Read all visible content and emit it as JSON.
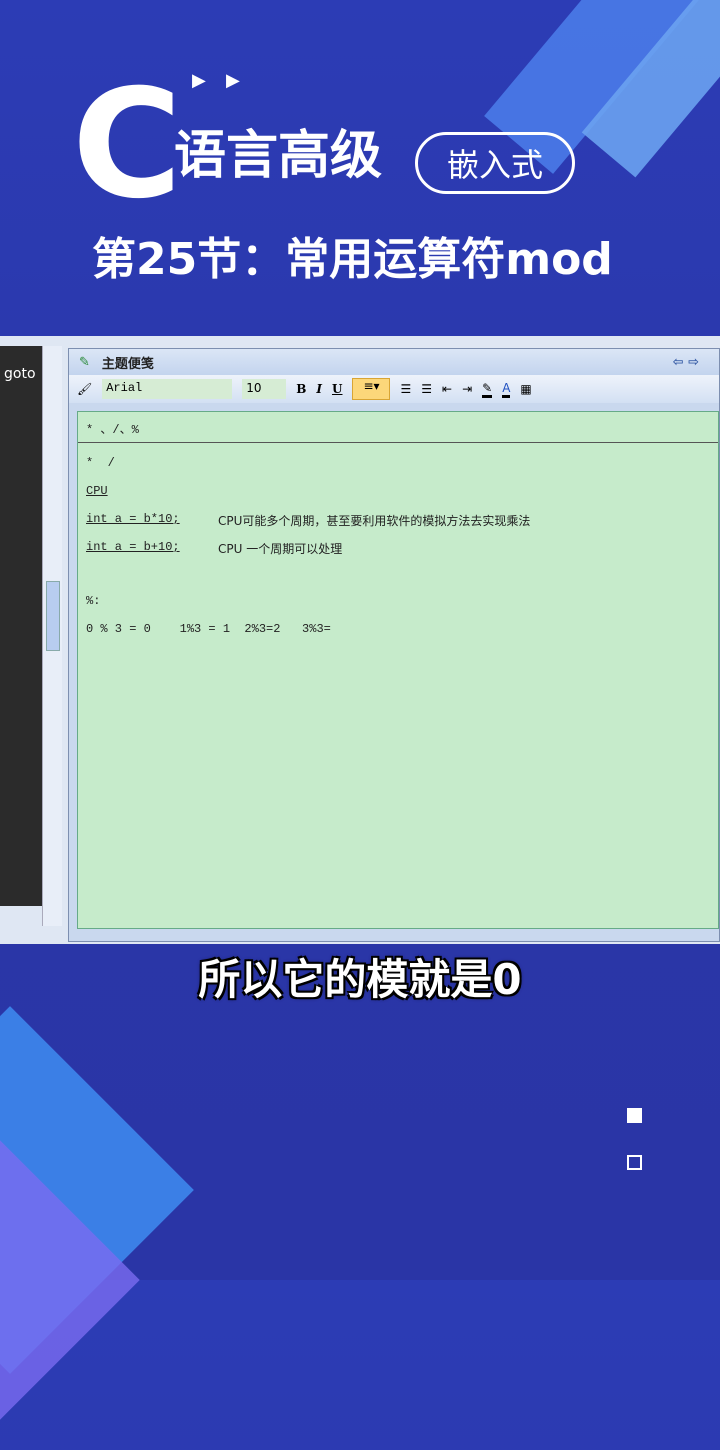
{
  "header": {
    "logo_letter": "C",
    "title": "语言高级",
    "badge": "嵌入式",
    "lesson": "第25节：常用运算符mod"
  },
  "left_pane": {
    "text": "goto"
  },
  "panel": {
    "title": "主题便笺",
    "font": "Arial",
    "size": "10",
    "bold": "B",
    "italic": "I",
    "underline": "U"
  },
  "doc": {
    "heading": "* 、/、%",
    "lines": [
      "*  /",
      "CPU",
      "int a = b*10;",
      "CPU可能多个周期，甚至要利用软件的模拟方法去实现乘法",
      "int a = b+10;",
      "CPU 一个周期可以处理",
      "%:",
      "0 % 3 = 0    1%3 = 1  2%3=2   3%3="
    ]
  },
  "subtitle": "所以它的模就是0"
}
